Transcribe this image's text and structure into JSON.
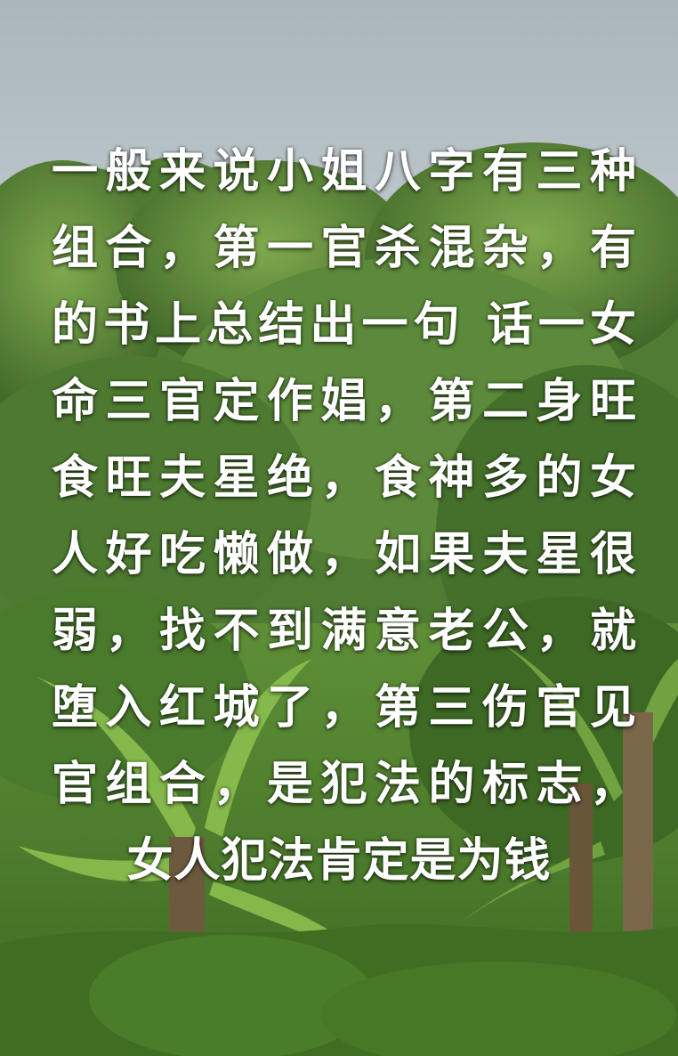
{
  "caption": {
    "lines": [
      "一般来说小姐八字有三种",
      "组合，第一官杀混杂，有",
      "的书上总结出一句 话一女",
      "命三官定作娼，第二身旺",
      "食旺夫星绝，食神多的女",
      "人好吃懒做，如果夫星很",
      "弱，找不到满意老公，就",
      "堕入红城了，第三伤官见",
      "官组合，是犯法的标志，",
      "女人犯法肯定是为钱"
    ]
  },
  "colors": {
    "sky": "#b9c3c7",
    "foliage_dark": "#2f4a22",
    "foliage_mid": "#5c8a3a",
    "foliage_light": "#8fbf5a",
    "ground": "#4e7a2c",
    "text": "#ffffff"
  }
}
